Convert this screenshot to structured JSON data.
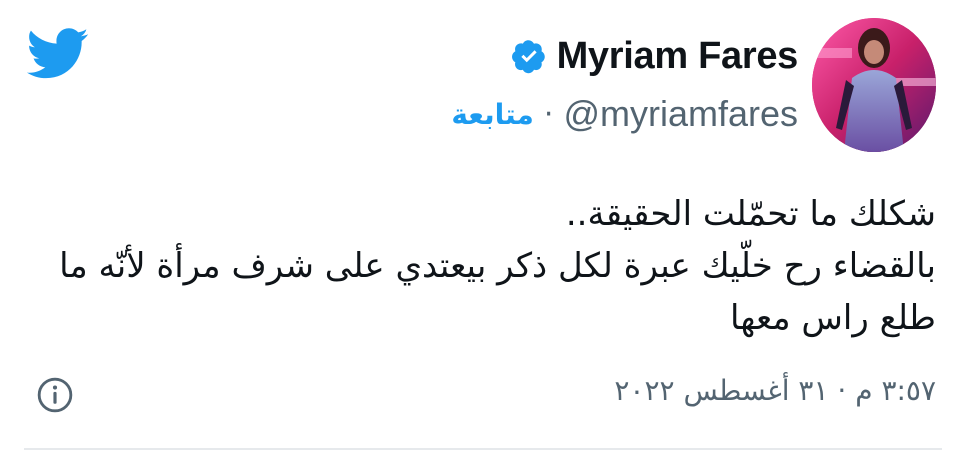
{
  "author": {
    "display_name": "Myriam Fares",
    "handle": "@myriamfares",
    "separator": "·",
    "follow_label": "متابعة"
  },
  "tweet": {
    "lines": [
      "شكلك ما تحمّلت الحقيقة..",
      "بالقضاء رح خلّيك عبرة لكل ذكر بيعتدي على شرف مرأة لأنّه ما",
      "طلع راس معها"
    ],
    "timestamp": "٣:٥٧ م · ٣١ أغسطس ٢٠٢٢"
  },
  "icons": {
    "brand": "twitter-bird-icon",
    "verified": "verified-badge-icon",
    "info": "info-icon"
  },
  "colors": {
    "twitter_blue": "#1d9bf0",
    "text_primary": "#0f1419",
    "text_secondary": "#536471",
    "divider": "#e6e9ec"
  }
}
